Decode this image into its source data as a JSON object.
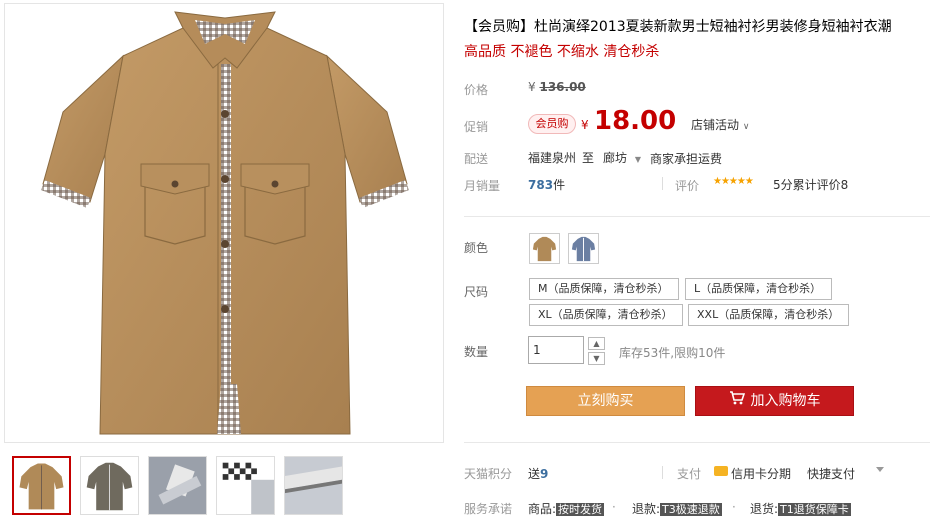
{
  "product": {
    "title": "【会员购】杜尚演绎2013夏装新款男士短袖衬衫男装修身短袖衬衣潮",
    "subtitle": "高品质 不褪色 不缩水 清仓秒杀"
  },
  "price": {
    "label": "价格",
    "currency": "¥",
    "original": "136.00",
    "promo_label": "促销",
    "promo_badge": "会员购",
    "sale": "18.00",
    "shop_activity": "店铺活动"
  },
  "shipping": {
    "label": "配送",
    "from": "福建泉州",
    "to_word": "至",
    "city": "廊坊",
    "fee": "商家承担运费"
  },
  "sales": {
    "label": "月销量",
    "count": "783",
    "unit": "件",
    "rating_label": "评价",
    "stars": "★★★★★",
    "rating_text": "5分累计评价8"
  },
  "color": {
    "label": "颜色",
    "options": [
      "khaki-shirt",
      "blue-plaid-shirt"
    ]
  },
  "size": {
    "label": "尺码",
    "options": [
      "M（品质保障，清仓秒杀）",
      "L（品质保障，清仓秒杀）",
      "XL（品质保障，清仓秒杀）",
      "XXL（品质保障，清仓秒杀）"
    ]
  },
  "quantity": {
    "label": "数量",
    "value": "1",
    "up": "▲",
    "down": "▼",
    "stock": "库存53件,限购10件"
  },
  "actions": {
    "buy_now": "立刻购买",
    "add_to_cart": "加入购物车"
  },
  "points": {
    "label": "天猫积分",
    "prefix": "送",
    "value": "9"
  },
  "payment": {
    "label": "支付",
    "card": "信用卡分期",
    "fast": "快捷支付"
  },
  "service": {
    "label": "服务承诺",
    "item1_label": "商品:",
    "item1_tag": "按时发货",
    "item2_label": "退款:",
    "item2_tag": "T3极速退款",
    "item3_label": "退货:",
    "item3_tag": "T1退货保障卡"
  },
  "colors": {
    "accent_red": "#c40000",
    "buy_orange": "#e5a153",
    "cart_red": "#c5191d",
    "khaki": "#b08a58"
  },
  "icons": [
    "cart-icon",
    "credit-card-icon",
    "chevron-down-icon",
    "star-icon"
  ]
}
